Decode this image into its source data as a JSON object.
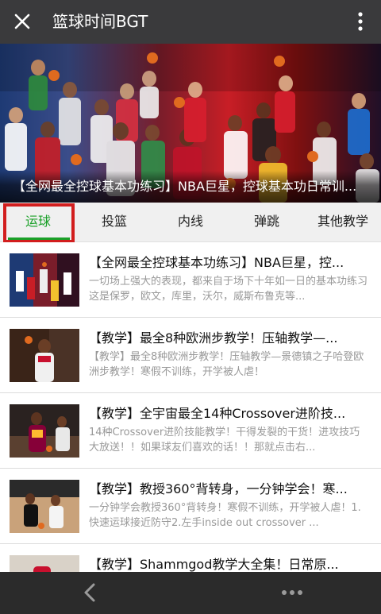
{
  "topbar": {
    "title": "篮球时间BGT",
    "close_icon": "close-icon",
    "more_icon": "more-vertical-icon"
  },
  "banner": {
    "caption": "【全网最全控球基本功练习】NBA巨星，控球基本功日常训..."
  },
  "tabs": [
    {
      "label": "运球",
      "active": true
    },
    {
      "label": "投篮",
      "active": false
    },
    {
      "label": "内线",
      "active": false
    },
    {
      "label": "弹跳",
      "active": false
    },
    {
      "label": "其他教学",
      "active": false
    }
  ],
  "articles": [
    {
      "title": "【全网最全控球基本功练习】NBA巨星，控...",
      "desc": "一切场上强大的表现，都来自于场下十年如一日的基本功练习这是保罗，欧文，库里，沃尔，威斯布鲁克等..."
    },
    {
      "title": "【教学】最全8种欧洲步教学！压轴教学—...",
      "desc": "【教学】最全8种欧洲步教学！压轴教学—景德镇之子哈登欧洲步教学！寒假不训练，开学被人虐！"
    },
    {
      "title": "【教学】全宇宙最全14种Crossover进阶技...",
      "desc": "14种Crossover进阶技能教学！干得发裂的干货！进攻技巧大放送！！如果球友们喜欢的话！！那就点击右..."
    },
    {
      "title": "【教学】教授360°背转身，一分钟学会！寒...",
      "desc": "一分钟学会教授360°背转身！寒假不训练，开学被人虐！1.快速运球接近防守2.左手inside out crossover ..."
    },
    {
      "title": "【教学】Shammgod教学大全集！日常原...",
      "desc": ""
    }
  ],
  "bottombar": {
    "back_icon": "back-chevron-icon",
    "more_icon": "more-horizontal-icon"
  },
  "colors": {
    "topbar": "#3a3a3c",
    "active_tab": "#1aa028",
    "highlight_border": "#d21e1e",
    "bottombar": "#2b2b2b"
  }
}
